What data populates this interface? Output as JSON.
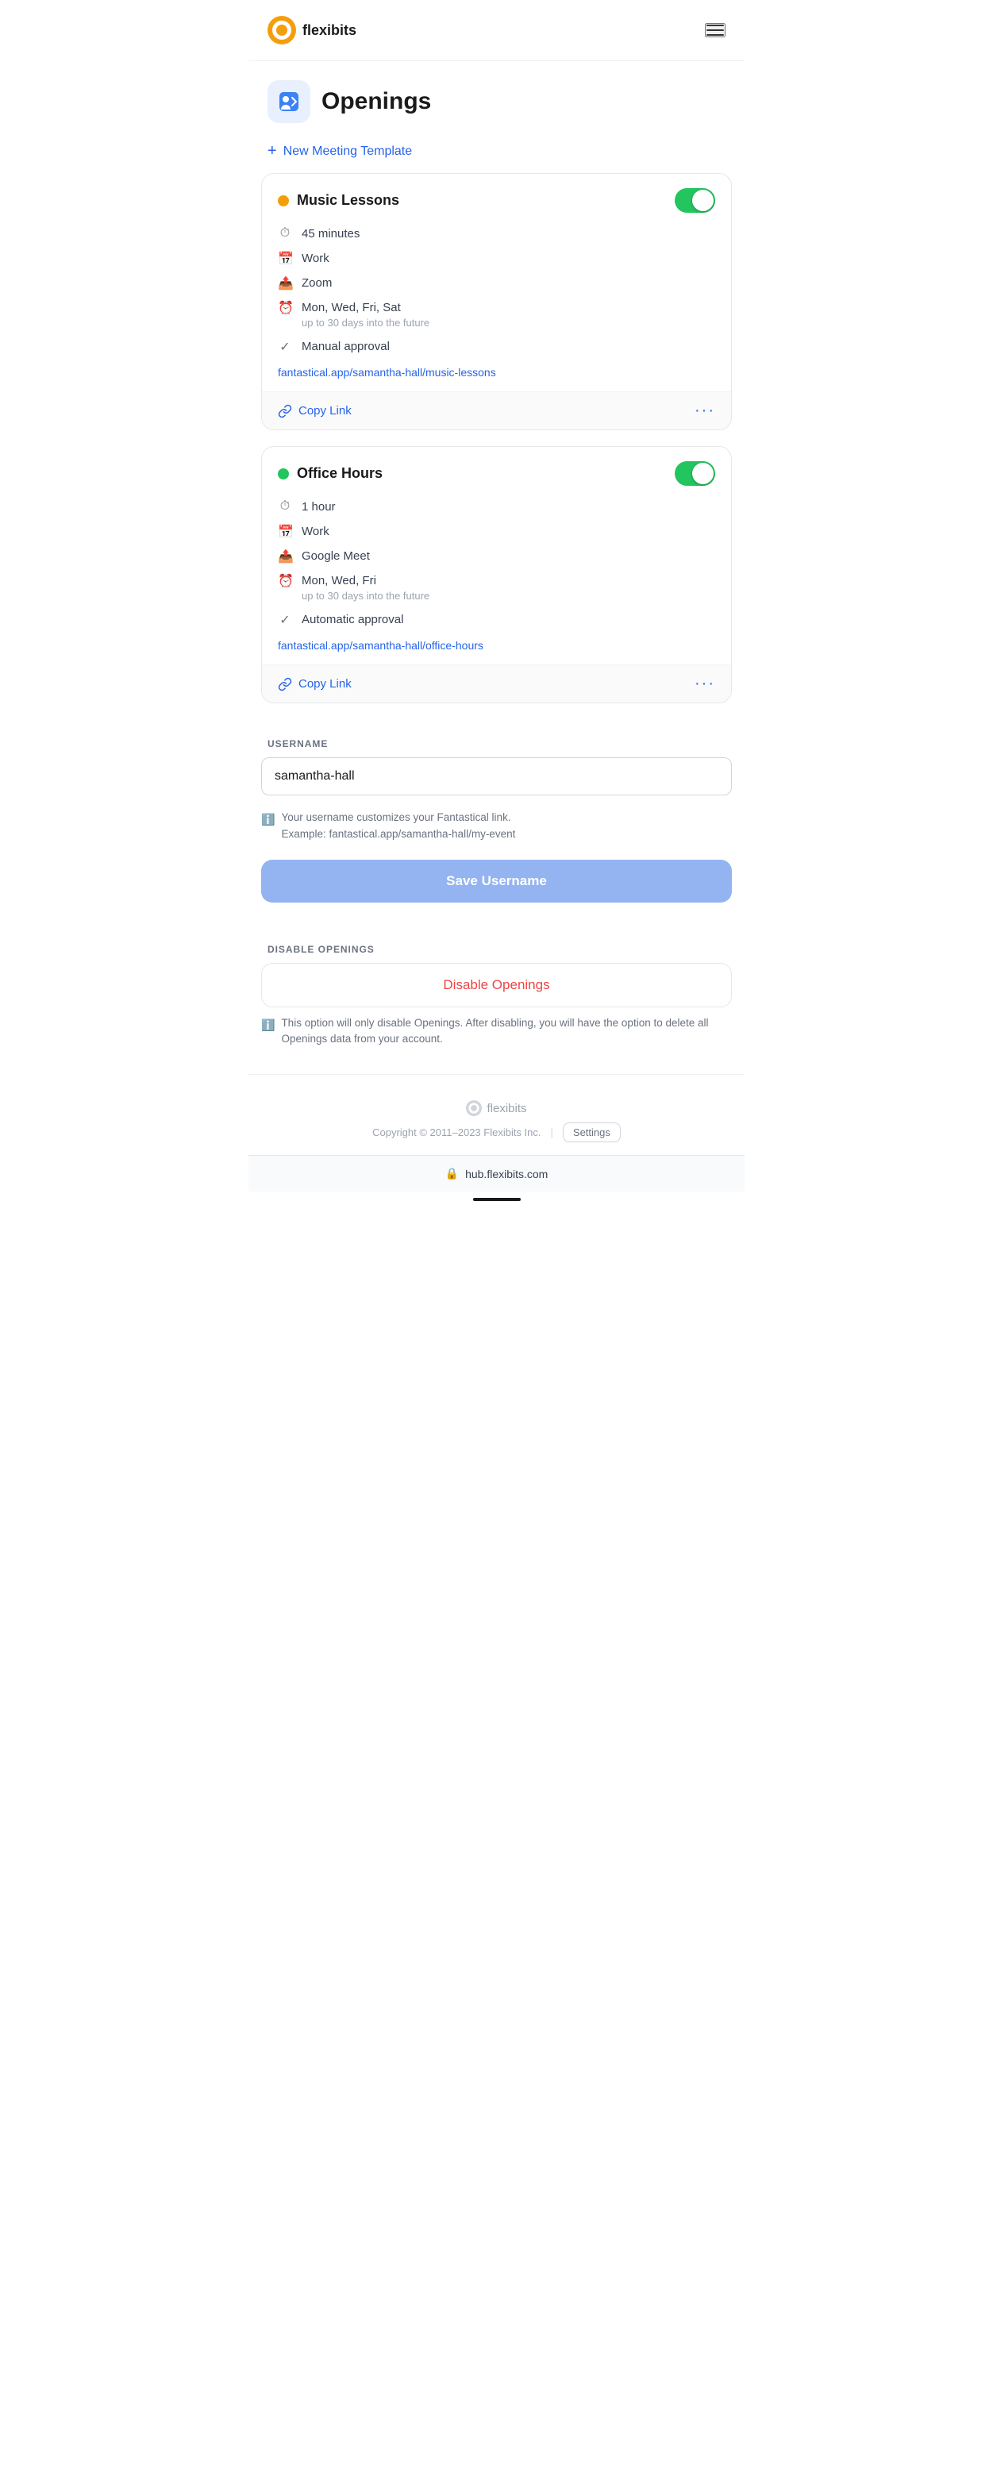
{
  "header": {
    "logo_text": "flexibits",
    "menu_label": "menu"
  },
  "page": {
    "title": "Openings",
    "new_template_label": "New Meeting Template"
  },
  "templates": [
    {
      "id": "music-lessons",
      "dot_color": "yellow",
      "title": "Music Lessons",
      "enabled": true,
      "duration": "45 minutes",
      "calendar": "Work",
      "conferencing": "Zoom",
      "schedule": "Mon, Wed, Fri, Sat",
      "schedule_sub": "up to 30 days into the future",
      "approval": "Manual approval",
      "link": "fantastical.app/samantha-hall/music-lessons",
      "copy_link_label": "Copy Link"
    },
    {
      "id": "office-hours",
      "dot_color": "green",
      "title": "Office Hours",
      "enabled": true,
      "duration": "1 hour",
      "calendar": "Work",
      "conferencing": "Google Meet",
      "schedule": "Mon, Wed, Fri",
      "schedule_sub": "up to 30 days into the future",
      "approval": "Automatic approval",
      "link": "fantastical.app/samantha-hall/office-hours",
      "copy_link_label": "Copy Link"
    }
  ],
  "username_section": {
    "heading": "USERNAME",
    "value": "samantha-hall",
    "hint_line1": "Your username customizes your Fantastical link.",
    "hint_line2": "Example: fantastical.app/samantha-hall/my-event",
    "save_label": "Save Username"
  },
  "disable_section": {
    "heading": "DISABLE OPENINGS",
    "button_label": "Disable Openings",
    "hint": "This option will only disable Openings. After disabling, you will have the option to delete all Openings data from your account."
  },
  "footer": {
    "logo_text": "flexibits",
    "copyright": "Copyright © 2011–2023 Flexibits Inc.",
    "separator": "|",
    "settings_label": "Settings"
  },
  "bottom_bar": {
    "domain": "hub.flexibits.com"
  }
}
